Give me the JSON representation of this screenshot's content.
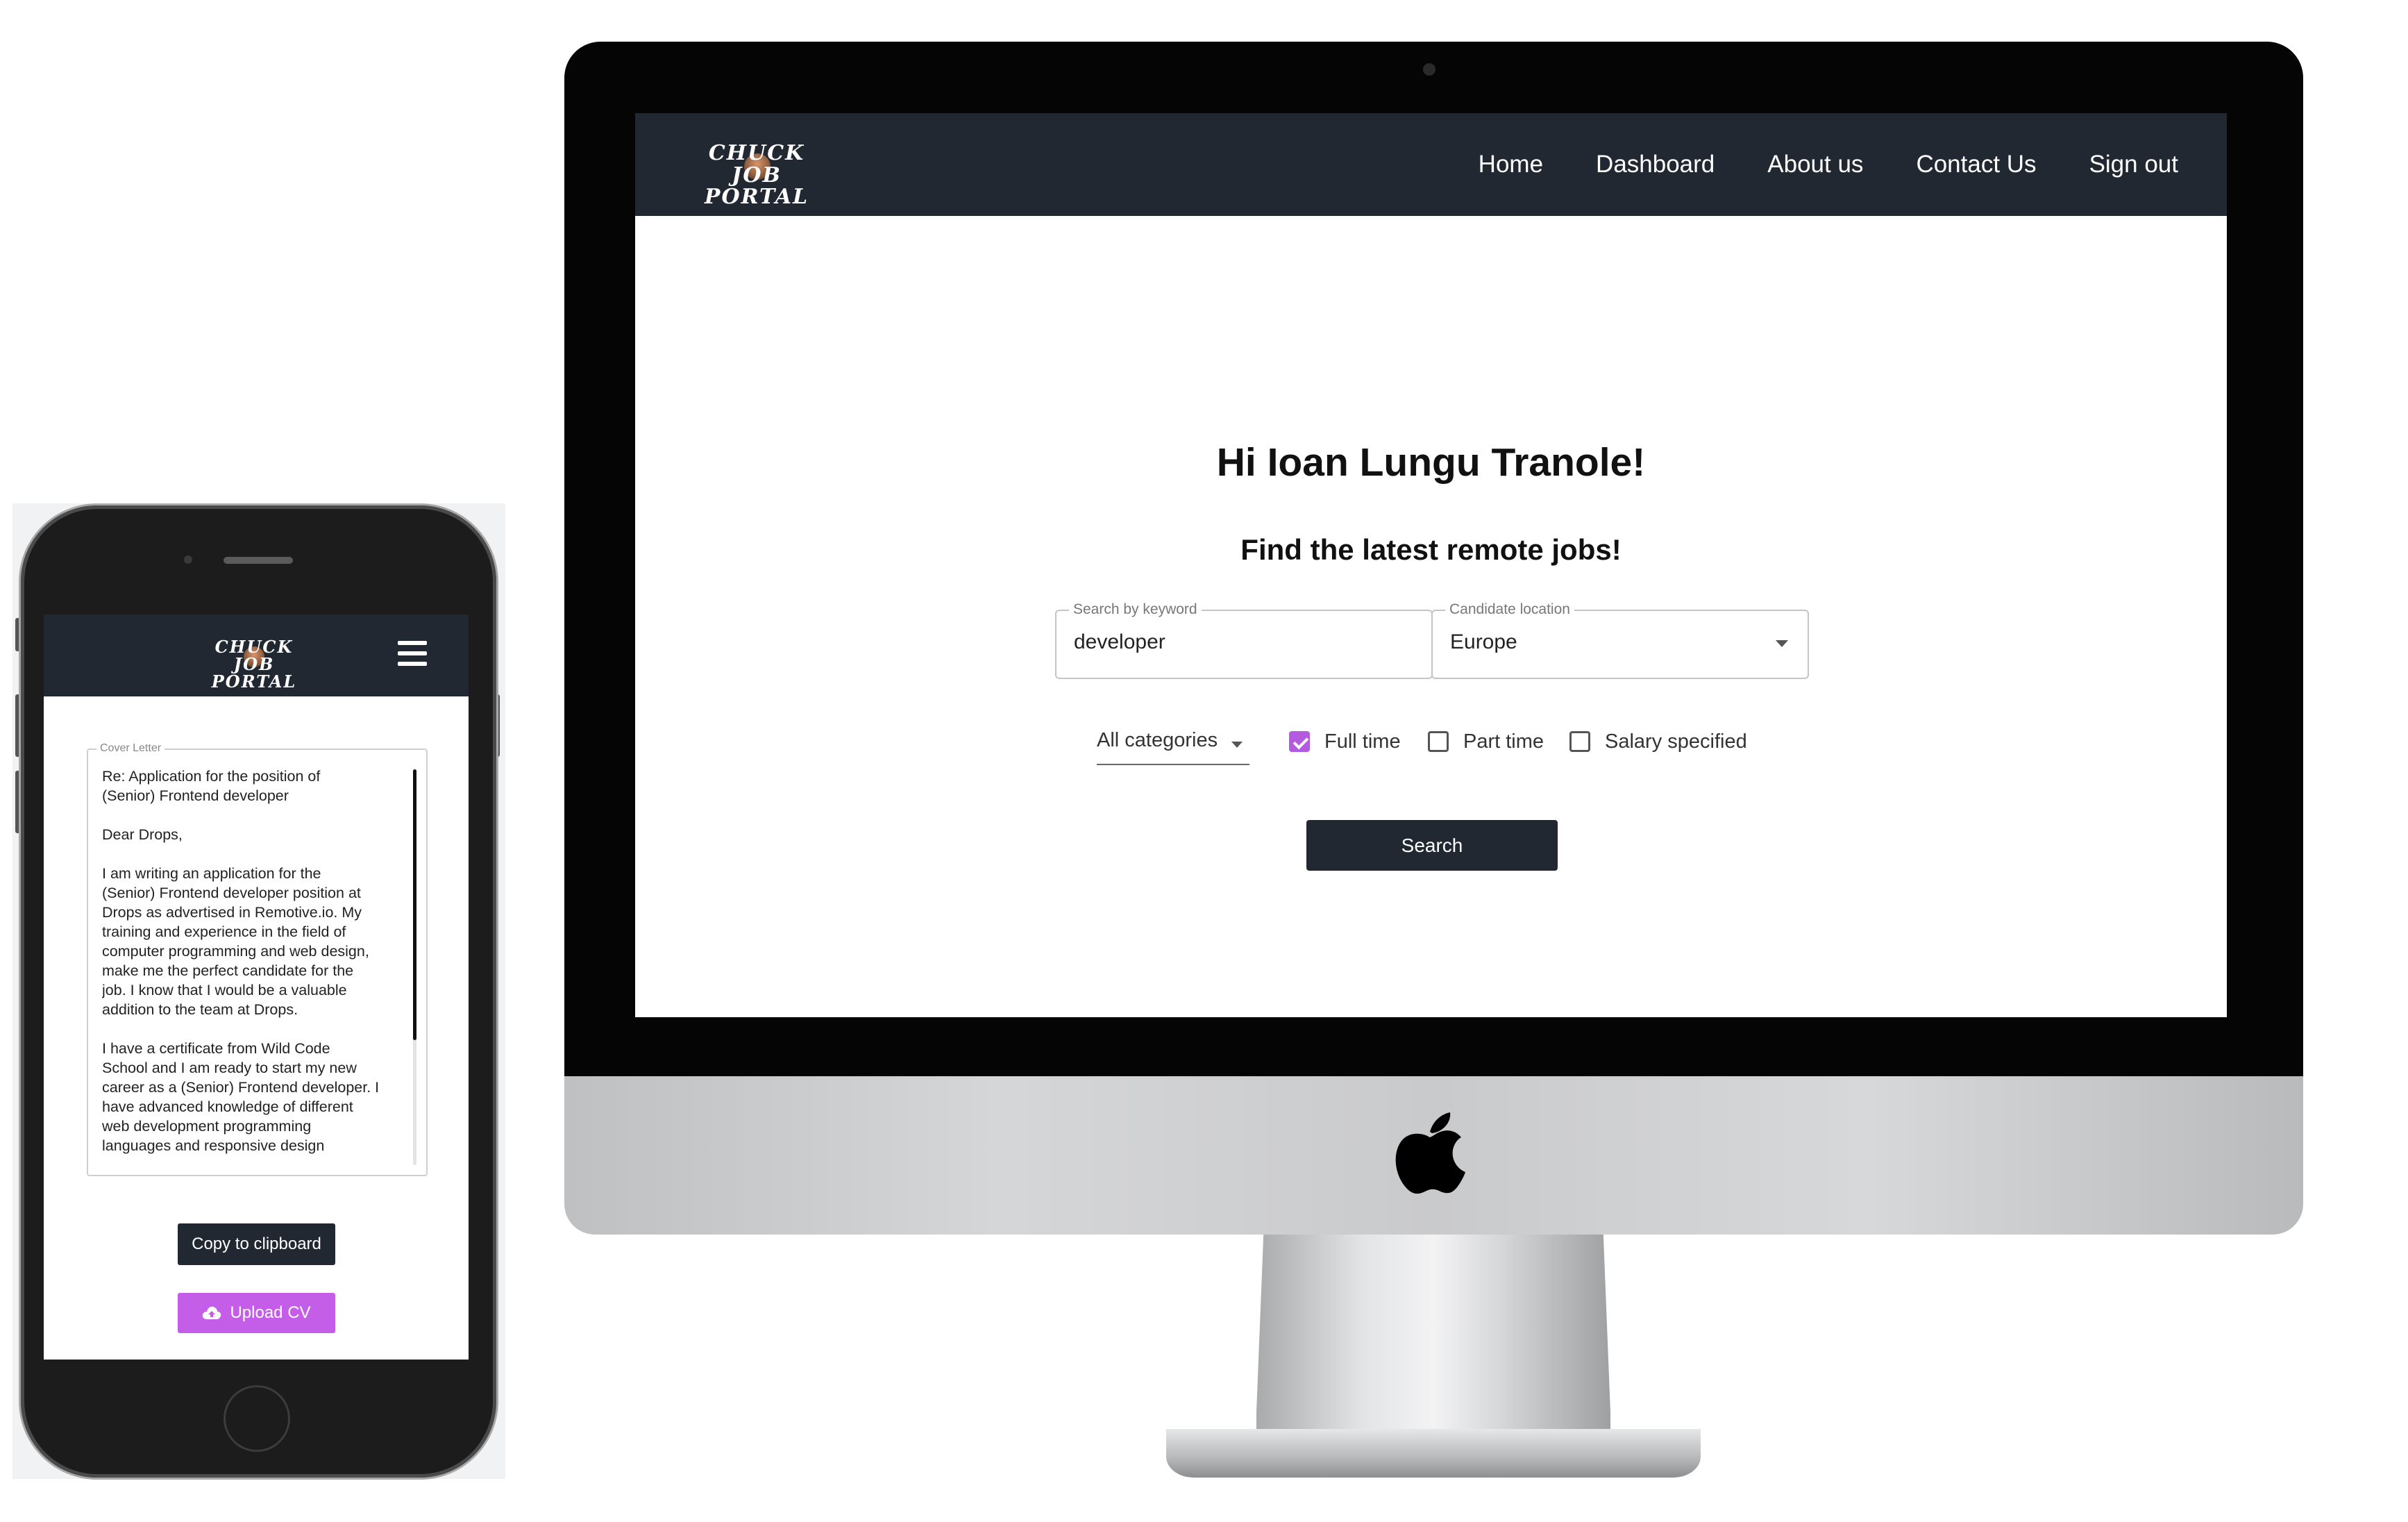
{
  "desktop": {
    "logo_line1": "CHUCK JOB",
    "logo_line2": "PORTAL",
    "nav": [
      "Home",
      "Dashboard",
      "About us",
      "Contact Us",
      "Sign out"
    ],
    "greeting": "Hi Ioan Lungu Tranole!",
    "subtitle": "Find the latest remote jobs!",
    "keyword": {
      "label": "Search by keyword",
      "value": "developer"
    },
    "location": {
      "label": "Candidate location",
      "value": "Europe"
    },
    "category": "All categories",
    "filters": [
      {
        "label": "Full time",
        "checked": true
      },
      {
        "label": "Part time",
        "checked": false
      },
      {
        "label": "Salary specified",
        "checked": false
      }
    ],
    "search_button": "Search",
    "accent_color": "#b45ae0",
    "nav_color": "#222831"
  },
  "mobile": {
    "logo_line1": "CHUCK JOB",
    "logo_line2": "PORTAL",
    "menu_icon": "hamburger-icon",
    "cover_label": "Cover Letter",
    "cover_text": "Re: Application for the position of\n(Senior) Frontend developer\n\nDear Drops,\n\nI am writing an application for the\n(Senior) Frontend developer position at\nDrops as advertised in Remotive.io. My\ntraining and experience in the field of\ncomputer programming and web design,\nmake me the perfect candidate for the\njob. I know that I would be a valuable\naddition to the team at Drops.\n\nI have a certificate from Wild Code\nSchool and I am ready to start my new\ncareer as a (Senior) Frontend developer. I\nhave advanced knowledge of different\nweb development programming\nlanguages and responsive design",
    "copy_button": "Copy to clipboard",
    "upload_button": "Upload CV",
    "upload_icon": "cloud-upload-icon",
    "upload_color": "#c45ee8"
  }
}
